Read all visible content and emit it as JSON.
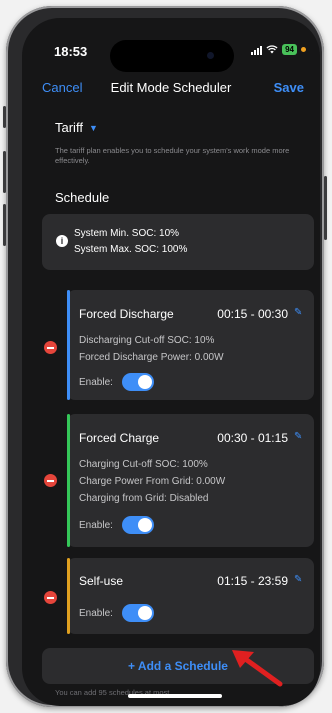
{
  "status_bar": {
    "time": "18:53",
    "battery": "94"
  },
  "nav": {
    "cancel": "Cancel",
    "title": "Edit Mode Scheduler",
    "save": "Save"
  },
  "tariff": {
    "label": "Tariff",
    "description": "The tariff plan enables you to schedule your system's work mode more effectively."
  },
  "schedule": {
    "title": "Schedule",
    "soc_min": "System Min. SOC: 10%",
    "soc_max": "System Max. SOC: 100%"
  },
  "cards": [
    {
      "title": "Forced Discharge",
      "time": "00:15 - 00:30",
      "accent": "#3e8ef7",
      "lines": [
        "Discharging Cut-off SOC: 10%",
        "Forced Discharge Power: 0.00W"
      ],
      "enable_label": "Enable:",
      "enabled": true
    },
    {
      "title": "Forced Charge",
      "time": "00:30 - 01:15",
      "accent": "#35c759",
      "lines": [
        "Charging Cut-off SOC: 100%",
        "Charge Power From Grid: 0.00W",
        "Charging from Grid: Disabled"
      ],
      "enable_label": "Enable:",
      "enabled": true
    },
    {
      "title": "Self-use",
      "time": "01:15 - 23:59",
      "accent": "#e0a020",
      "lines": [],
      "enable_label": "Enable:",
      "enabled": true
    }
  ],
  "add_schedule": "+ Add a Schedule",
  "footnote": "You can add 95 schedules at most",
  "colors": {
    "accent": "#3e8ef7",
    "danger": "#e5453b",
    "background": "#161617",
    "card": "#2c2c2e"
  }
}
